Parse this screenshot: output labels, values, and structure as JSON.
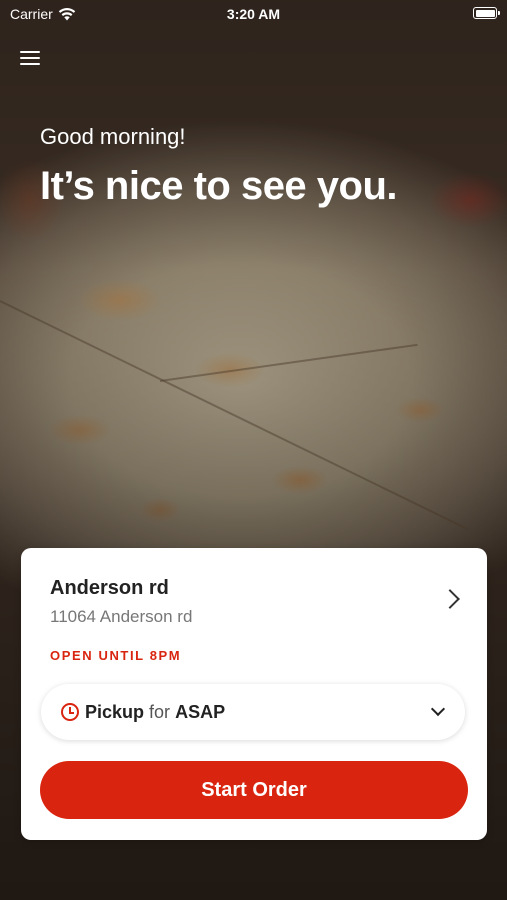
{
  "status_bar": {
    "carrier": "Carrier",
    "time": "3:20 AM"
  },
  "header": {
    "greeting": "Good morning!",
    "headline": "It’s nice to see you."
  },
  "store": {
    "name": "Anderson rd",
    "address": "11064 Anderson rd",
    "hours": "OPEN UNTIL 8PM"
  },
  "order_mode": {
    "mode": "Pickup",
    "connector": "for",
    "time": "ASAP"
  },
  "actions": {
    "start_order": "Start Order"
  },
  "colors": {
    "accent": "#d9250f"
  },
  "icons": [
    "wifi-icon",
    "battery-icon",
    "menu-icon",
    "chevron-right-icon",
    "clock-icon",
    "chevron-down-icon"
  ]
}
